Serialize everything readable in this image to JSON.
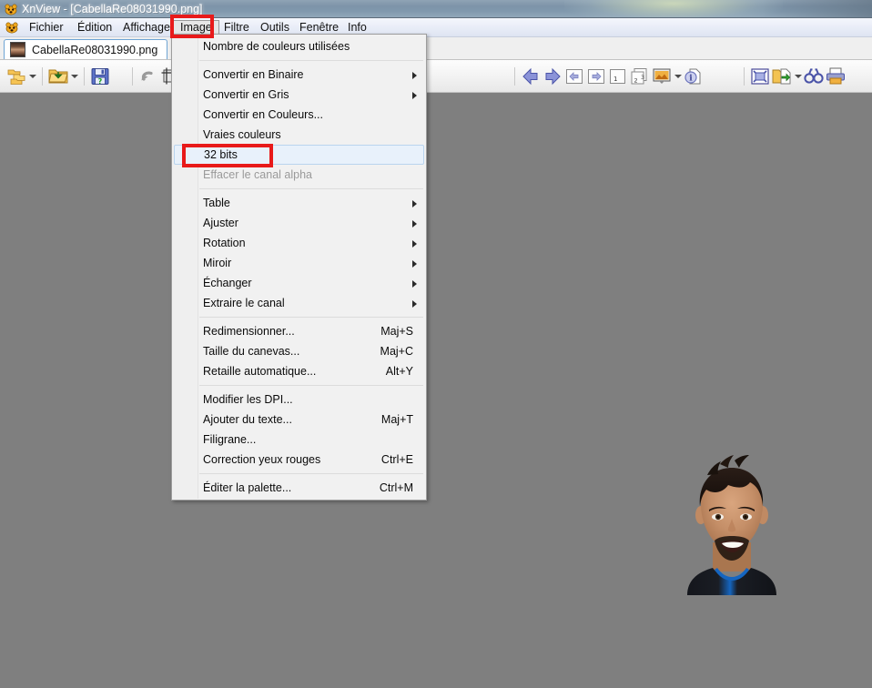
{
  "window": {
    "title": "XnView - [CabellaRe08031990.png]",
    "app_icon": "xnview-icon"
  },
  "menubar": {
    "icon": "xnview-small-icon",
    "items": [
      {
        "label": "Fichier",
        "name": "menu-fichier",
        "open": false
      },
      {
        "label": "Édition",
        "name": "menu-edition",
        "open": false
      },
      {
        "label": "Affichage",
        "name": "menu-affichage",
        "open": false
      },
      {
        "label": "Image",
        "name": "menu-image",
        "open": true
      },
      {
        "label": "Filtre",
        "name": "menu-filtre",
        "open": false
      },
      {
        "label": "Outils",
        "name": "menu-outils",
        "open": false
      },
      {
        "label": "Fenêtre",
        "name": "menu-fenetre",
        "open": false
      },
      {
        "label": "Info",
        "name": "menu-info",
        "open": false
      }
    ]
  },
  "tabs": [
    {
      "label": "CabellaRe08031990.png",
      "name": "tab-cabellare",
      "active": true,
      "thumbnail": "image-thumbnail"
    }
  ],
  "toolbar": {
    "groups": [
      {
        "name": "file-group",
        "buttons": [
          {
            "name": "browser-icon",
            "dropdown": true
          },
          {
            "name": "open-folder-icon",
            "dropdown": true
          },
          {
            "name": "save-icon",
            "dropdown": false
          }
        ]
      },
      {
        "name": "edit-group",
        "buttons": [
          {
            "name": "undo-icon",
            "dropdown": false
          },
          {
            "name": "crop-icon",
            "dropdown": false
          },
          {
            "name": "copy-icon",
            "dropdown": false
          },
          {
            "name": "paste-icon",
            "dropdown": false
          },
          {
            "name": "delete-icon",
            "dropdown": false
          }
        ]
      },
      {
        "name": "zoom-group",
        "buttons": [
          {
            "name": "zoom-in-icon",
            "dropdown": false
          },
          {
            "name": "zoom-actual-size-icon",
            "dropdown": true
          },
          {
            "name": "zoom-out-icon",
            "dropdown": false
          }
        ]
      },
      {
        "name": "navigation-group",
        "buttons": [
          {
            "name": "previous-image-icon",
            "dropdown": false
          },
          {
            "name": "next-image-icon",
            "dropdown": false
          },
          {
            "name": "first-image-icon",
            "dropdown": false
          },
          {
            "name": "last-image-icon",
            "dropdown": false
          },
          {
            "name": "page-previous-icon",
            "dropdown": false
          },
          {
            "name": "page-next-icon",
            "dropdown": false
          },
          {
            "name": "fullscreen-icon",
            "dropdown": true
          },
          {
            "name": "image-info-icon",
            "dropdown": false
          }
        ]
      },
      {
        "name": "tools-group",
        "buttons": [
          {
            "name": "fit-to-window-icon",
            "dropdown": false
          },
          {
            "name": "batch-convert-icon",
            "dropdown": true
          },
          {
            "name": "find-icon",
            "dropdown": false
          },
          {
            "name": "print-icon",
            "dropdown": false
          }
        ]
      }
    ]
  },
  "image_menu": {
    "name": "image-dropdown-menu",
    "items": [
      {
        "type": "item",
        "label": "Nombre de couleurs utilisées",
        "accel": "",
        "submenu": false,
        "disabled": false,
        "highlighted": false,
        "name": "menuitem-nombre-de-couleurs-utilisees"
      },
      {
        "type": "separator"
      },
      {
        "type": "item",
        "label": "Convertir en Binaire",
        "accel": "",
        "submenu": true,
        "disabled": false,
        "highlighted": false,
        "name": "menuitem-convertir-en-binaire"
      },
      {
        "type": "item",
        "label": "Convertir en Gris",
        "accel": "",
        "submenu": true,
        "disabled": false,
        "highlighted": false,
        "name": "menuitem-convertir-en-gris"
      },
      {
        "type": "item",
        "label": "Convertir en Couleurs...",
        "accel": "",
        "submenu": false,
        "disabled": false,
        "highlighted": false,
        "name": "menuitem-convertir-en-couleurs"
      },
      {
        "type": "item",
        "label": "Vraies couleurs",
        "accel": "",
        "submenu": false,
        "disabled": false,
        "highlighted": false,
        "name": "menuitem-vraies-couleurs"
      },
      {
        "type": "item",
        "label": "32 bits",
        "accel": "",
        "submenu": false,
        "disabled": false,
        "highlighted": true,
        "name": "menuitem-32-bits"
      },
      {
        "type": "item",
        "label": "Effacer le canal alpha",
        "accel": "",
        "submenu": false,
        "disabled": true,
        "highlighted": false,
        "name": "menuitem-effacer-le-canal-alpha"
      },
      {
        "type": "separator"
      },
      {
        "type": "item",
        "label": "Table",
        "accel": "",
        "submenu": true,
        "disabled": false,
        "highlighted": false,
        "name": "menuitem-table"
      },
      {
        "type": "item",
        "label": "Ajuster",
        "accel": "",
        "submenu": true,
        "disabled": false,
        "highlighted": false,
        "name": "menuitem-ajuster"
      },
      {
        "type": "item",
        "label": "Rotation",
        "accel": "",
        "submenu": true,
        "disabled": false,
        "highlighted": false,
        "name": "menuitem-rotation"
      },
      {
        "type": "item",
        "label": "Miroir",
        "accel": "",
        "submenu": true,
        "disabled": false,
        "highlighted": false,
        "name": "menuitem-miroir"
      },
      {
        "type": "item",
        "label": "Échanger",
        "accel": "",
        "submenu": true,
        "disabled": false,
        "highlighted": false,
        "name": "menuitem-echanger"
      },
      {
        "type": "item",
        "label": "Extraire le canal",
        "accel": "",
        "submenu": true,
        "disabled": false,
        "highlighted": false,
        "name": "menuitem-extraire-le-canal"
      },
      {
        "type": "separator"
      },
      {
        "type": "item",
        "label": "Redimensionner...",
        "accel": "Maj+S",
        "submenu": false,
        "disabled": false,
        "highlighted": false,
        "name": "menuitem-redimensionner"
      },
      {
        "type": "item",
        "label": "Taille du canevas...",
        "accel": "Maj+C",
        "submenu": false,
        "disabled": false,
        "highlighted": false,
        "name": "menuitem-taille-du-canevas"
      },
      {
        "type": "item",
        "label": "Retaille automatique...",
        "accel": "Alt+Y",
        "submenu": false,
        "disabled": false,
        "highlighted": false,
        "name": "menuitem-retaille-automatique"
      },
      {
        "type": "separator"
      },
      {
        "type": "item",
        "label": "Modifier les DPI...",
        "accel": "",
        "submenu": false,
        "disabled": false,
        "highlighted": false,
        "name": "menuitem-modifier-les-dpi"
      },
      {
        "type": "item",
        "label": "Ajouter du texte...",
        "accel": "Maj+T",
        "submenu": false,
        "disabled": false,
        "highlighted": false,
        "name": "menuitem-ajouter-du-texte"
      },
      {
        "type": "item",
        "label": "Filigrane...",
        "accel": "",
        "submenu": false,
        "disabled": false,
        "highlighted": false,
        "name": "menuitem-filigrane"
      },
      {
        "type": "item",
        "label": "Correction yeux rouges",
        "accel": "Ctrl+E",
        "submenu": false,
        "disabled": false,
        "highlighted": false,
        "name": "menuitem-correction-yeux-rouges"
      },
      {
        "type": "separator"
      },
      {
        "type": "item",
        "label": "Éditer la palette...",
        "accel": "Ctrl+M",
        "submenu": false,
        "disabled": false,
        "highlighted": false,
        "name": "menuitem-editer-la-palette"
      }
    ]
  },
  "canvas": {
    "background_color": "#7f7f7f",
    "image_name": "portrait-photo"
  },
  "annotations": [
    {
      "name": "red-highlight-image-menu",
      "target": "Image"
    },
    {
      "name": "red-highlight-32-bits",
      "target": "32 bits"
    }
  ],
  "colors": {
    "annotation_red": "#e81a1a",
    "canvas_gray": "#7f7f7f",
    "menu_bg": "#f1f1f1",
    "highlight_blue": "#e8f1fb",
    "tab_border": "#6ea4d4"
  }
}
